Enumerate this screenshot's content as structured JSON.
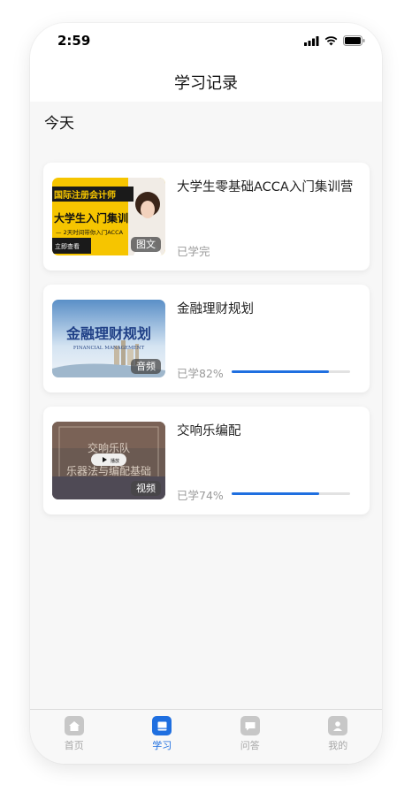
{
  "status_bar": {
    "time": "2:59"
  },
  "nav": {
    "title": "学习记录"
  },
  "section": {
    "title": "今天"
  },
  "cards": [
    {
      "title": "大学生零基础ACCA入门集训营",
      "type_badge": "图文",
      "progress_text": "已学完",
      "thumb_texts": {
        "line1": "国际注册会计师",
        "line2": "大学生入门集训",
        "line3": "— 2天时间带你入门ACCA",
        "line4": "立即查看"
      }
    },
    {
      "title": "金融理财规划",
      "type_badge": "音频",
      "progress_text": "已学82%",
      "progress": 0.82,
      "thumb_texts": {
        "main": "金融理财规划",
        "sub": "FINANCIAL MANAGEMENT"
      }
    },
    {
      "title": "交响乐编配",
      "type_badge": "视频",
      "progress_text": "已学74%",
      "progress": 0.74,
      "thumb_texts": {
        "line1": "交响乐队",
        "line2": "乐器法与编配基础",
        "play": "播放"
      }
    }
  ],
  "tabs": [
    {
      "label": "首页",
      "icon": "home-icon",
      "active": false
    },
    {
      "label": "学习",
      "icon": "book-icon",
      "active": true
    },
    {
      "label": "问答",
      "icon": "chat-icon",
      "active": false
    },
    {
      "label": "我的",
      "icon": "user-icon",
      "active": false
    }
  ],
  "colors": {
    "accent": "#1f6fe0",
    "inactive": "#c7c7c7"
  }
}
